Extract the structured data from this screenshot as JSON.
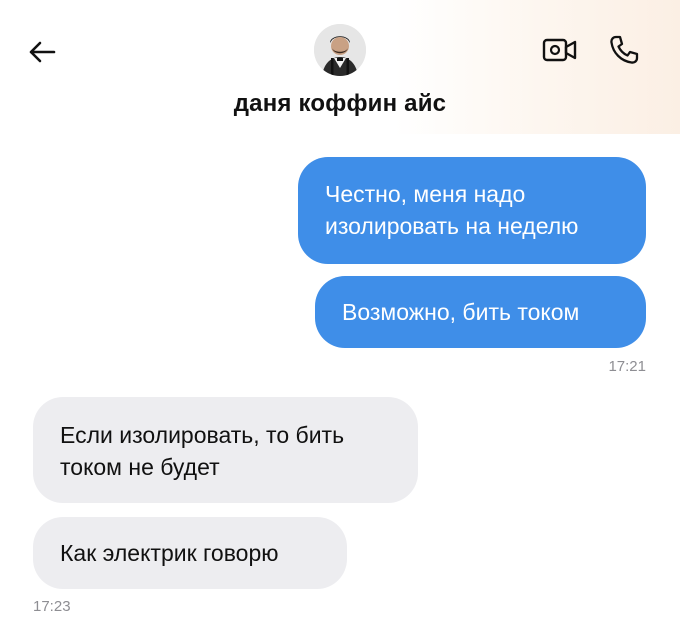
{
  "header": {
    "contact_name": "даня коффин айс",
    "icons": {
      "back": "arrow-left-icon",
      "avatar": "contact-avatar",
      "video": "video-camera-icon",
      "call": "phone-icon"
    }
  },
  "messages": [
    {
      "direction": "outgoing",
      "text": "Честно, меня надо\nизолировать на неделю"
    },
    {
      "direction": "outgoing",
      "text": "Возможно, бить током"
    },
    {
      "direction": "incoming",
      "text": "Если изолировать, то бить\nтоком не будет"
    },
    {
      "direction": "incoming",
      "text": "Как электрик говорю"
    }
  ],
  "timestamps": {
    "outgoing_group": "17:21",
    "incoming_group": "17:23"
  },
  "colors": {
    "outgoing_bubble": "#3f8ee8",
    "incoming_bubble": "#ededf0",
    "timestamp": "#8e8e93"
  }
}
